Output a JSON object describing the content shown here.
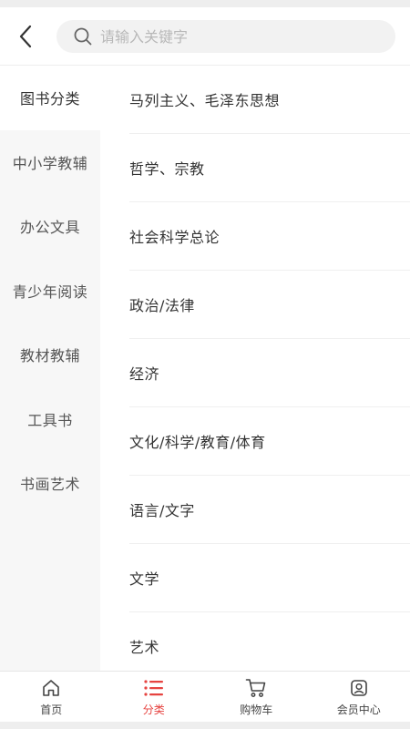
{
  "search": {
    "placeholder": "请输入关键字"
  },
  "sidebar": {
    "items": [
      {
        "label": "图书分类",
        "active": true
      },
      {
        "label": "中小学教辅",
        "active": false
      },
      {
        "label": "办公文具",
        "active": false
      },
      {
        "label": "青少年阅读",
        "active": false
      },
      {
        "label": "教材教辅",
        "active": false
      },
      {
        "label": "工具书",
        "active": false
      },
      {
        "label": "书画艺术",
        "active": false
      }
    ]
  },
  "categories": [
    "马列主义、毛泽东思想",
    "哲学、宗教",
    "社会科学总论",
    "政治/法律",
    "经济",
    "文化/科学/教育/体育",
    "语言/文字",
    "文学",
    "艺术"
  ],
  "tabbar": {
    "tabs": [
      {
        "label": "首页",
        "icon": "home-icon",
        "active": false
      },
      {
        "label": "分类",
        "icon": "category-list-icon",
        "active": true
      },
      {
        "label": "购物车",
        "icon": "cart-icon",
        "active": false
      },
      {
        "label": "会员中心",
        "icon": "member-icon",
        "active": false
      }
    ]
  },
  "colors": {
    "accent": "#e64340",
    "sidebar_bg": "#f7f7f7",
    "search_bg": "#f2f2f2"
  }
}
